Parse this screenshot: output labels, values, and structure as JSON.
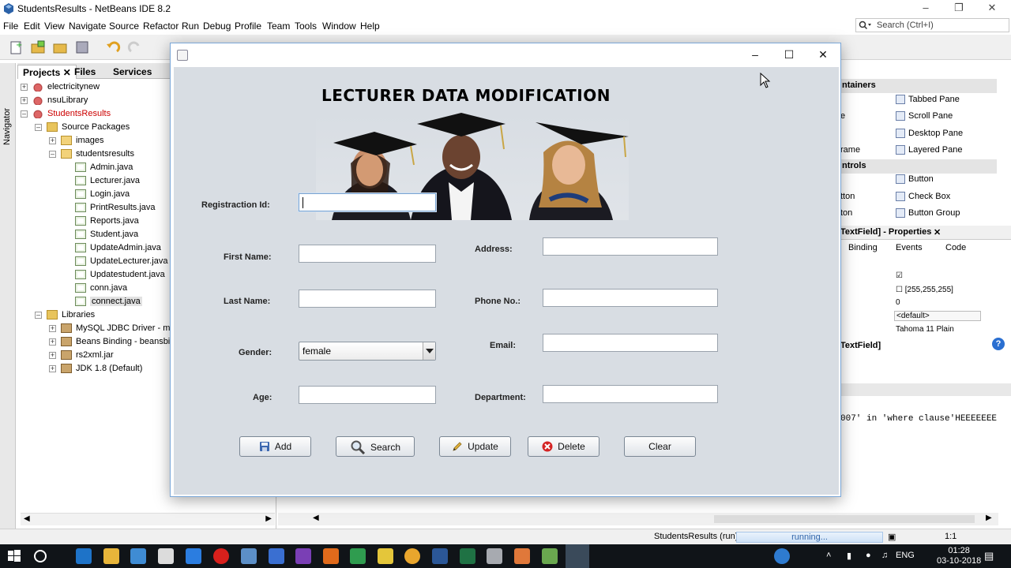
{
  "ide": {
    "title": "StudentsResults - NetBeans IDE 8.2",
    "menu": [
      "File",
      "Edit",
      "View",
      "Navigate",
      "Source",
      "Refactor",
      "Run",
      "Debug",
      "Profile",
      "Team",
      "Tools",
      "Window",
      "Help"
    ],
    "search_placeholder": "Search (Ctrl+I)",
    "navigator_label": "Navigator",
    "project_tabs": [
      "Projects",
      "Files",
      "Services"
    ],
    "tree": [
      {
        "label": "electricitynew",
        "type": "proj",
        "depth": 0,
        "exp": "+"
      },
      {
        "label": "nsuLibrary",
        "type": "proj",
        "depth": 0,
        "exp": "+"
      },
      {
        "label": "StudentsResults",
        "type": "proj",
        "depth": 0,
        "exp": "-",
        "red": true
      },
      {
        "label": "Source Packages",
        "type": "folder",
        "depth": 1,
        "exp": "-"
      },
      {
        "label": "images",
        "type": "pkg",
        "depth": 2,
        "exp": "+"
      },
      {
        "label": "studentsresults",
        "type": "pkg",
        "depth": 2,
        "exp": "-"
      },
      {
        "label": "Admin.java",
        "type": "java",
        "depth": 3
      },
      {
        "label": "Lecturer.java",
        "type": "java",
        "depth": 3
      },
      {
        "label": "Login.java",
        "type": "java",
        "depth": 3
      },
      {
        "label": "PrintResults.java",
        "type": "java",
        "depth": 3
      },
      {
        "label": "Reports.java",
        "type": "java",
        "depth": 3
      },
      {
        "label": "Student.java",
        "type": "java",
        "depth": 3
      },
      {
        "label": "UpdateAdmin.java",
        "type": "java",
        "depth": 3
      },
      {
        "label": "UpdateLecturer.java",
        "type": "java",
        "depth": 3
      },
      {
        "label": "Updatestudent.java",
        "type": "java",
        "depth": 3
      },
      {
        "label": "conn.java",
        "type": "java",
        "depth": 3
      },
      {
        "label": "connect.java",
        "type": "java",
        "depth": 3,
        "selected": true
      },
      {
        "label": "Libraries",
        "type": "folder",
        "depth": 1,
        "exp": "-"
      },
      {
        "label": "MySQL JDBC Driver - mysq",
        "type": "jar",
        "depth": 2,
        "exp": "+"
      },
      {
        "label": "Beans Binding - beansbind",
        "type": "jar",
        "depth": 2,
        "exp": "+"
      },
      {
        "label": "rs2xml.jar",
        "type": "jar",
        "depth": 2,
        "exp": "+"
      },
      {
        "label": "JDK 1.8 (Default)",
        "type": "jar",
        "depth": 2,
        "exp": "+"
      }
    ],
    "palette": {
      "section1": "ntainers",
      "section2": "ntrols",
      "items_right": [
        "Tabbed Pane",
        "Scroll Pane",
        "Desktop Pane",
        "Layered Pane",
        "Button",
        "Check Box",
        "Button Group"
      ],
      "items_left": [
        "e",
        "rame",
        "tton",
        "ton"
      ]
    },
    "properties": {
      "title": "TextField] - Properties",
      "tabs": [
        "Binding",
        "Events",
        "Code"
      ],
      "rows": [
        "[255,255,255]",
        "0",
        "<default>",
        "Tahoma 11 Plain"
      ],
      "footer": "TextField]"
    },
    "output_line": "007' in 'where clause'HEEEEEEE",
    "status": {
      "running_label": "StudentsResults (run)",
      "progress_text": "running...",
      "position": "1:1"
    },
    "taskbar": {
      "lang": "ENG",
      "time": "01:28",
      "date": "03-10-2018"
    }
  },
  "dialog": {
    "title": "LECTURER DATA MODIFICATION",
    "labels": {
      "reg_id": "Registraction Id:",
      "first_name": "First Name:",
      "last_name": "Last Name:",
      "gender": "Gender:",
      "age": "Age:",
      "address": "Address:",
      "phone": "Phone No.:",
      "email": "Email:",
      "department": "Department:"
    },
    "values": {
      "reg_id": "",
      "first_name": "",
      "last_name": "",
      "age": "",
      "address": "",
      "phone": "",
      "email": "",
      "department": ""
    },
    "gender_selected": "female",
    "buttons": {
      "add": "Add",
      "search": "Search",
      "update": "Update",
      "delete": "Delete",
      "clear": "Clear"
    }
  }
}
